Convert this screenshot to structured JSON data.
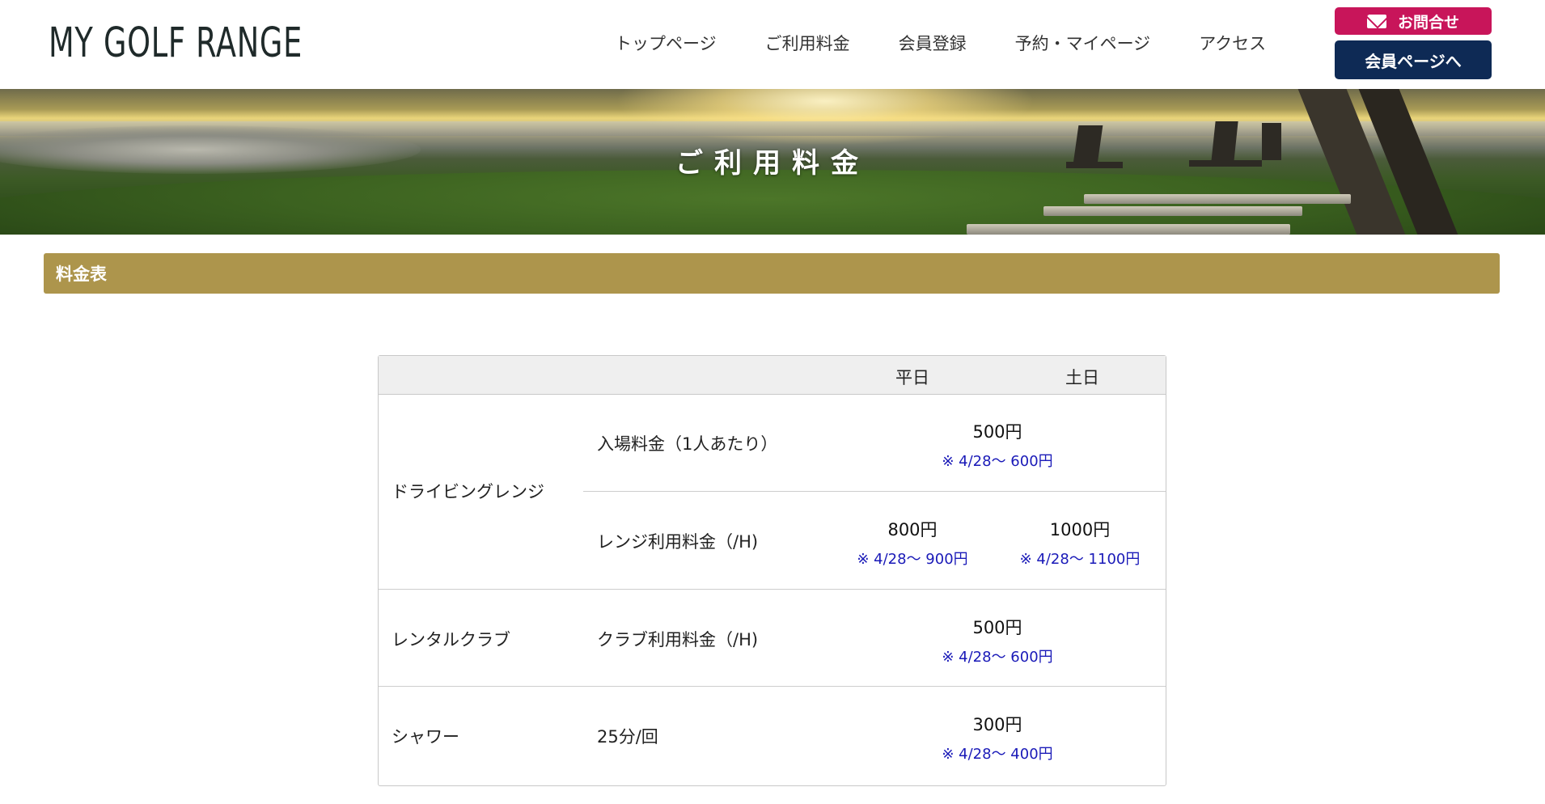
{
  "header": {
    "logo": "MY GOLF RANGE",
    "nav": [
      "トップページ",
      "ご利用料金",
      "会員登録",
      "予約・マイページ",
      "アクセス"
    ],
    "contact_label": "お問合せ",
    "member_label": "会員ページへ",
    "colors": {
      "contact": "#c8155a",
      "member": "#0e2a55"
    }
  },
  "hero": {
    "title": "ご利用料金"
  },
  "section": {
    "title": "料金表",
    "color": "#ad954c"
  },
  "table": {
    "col_weekday": "平日",
    "col_weekend": "土日",
    "rows": [
      {
        "category": "ドライビングレンジ",
        "item": "入場料金（1人あたり）",
        "price": "500円",
        "note": "※ 4/28～ 600円"
      },
      {
        "item": "レンジ利用料金（/H)",
        "weekday_price": "800円",
        "weekday_note": "※ 4/28～ 900円",
        "weekend_price": "1000円",
        "weekend_note": "※ 4/28～ 1100円"
      },
      {
        "category": "レンタルクラブ",
        "item": "クラブ利用料金（/H)",
        "price": "500円",
        "note": "※ 4/28～ 600円"
      },
      {
        "category": "シャワー",
        "item": "25分/回",
        "price": "300円",
        "note": "※ 4/28～ 400円"
      }
    ],
    "note_color": "#1a1ab8"
  }
}
